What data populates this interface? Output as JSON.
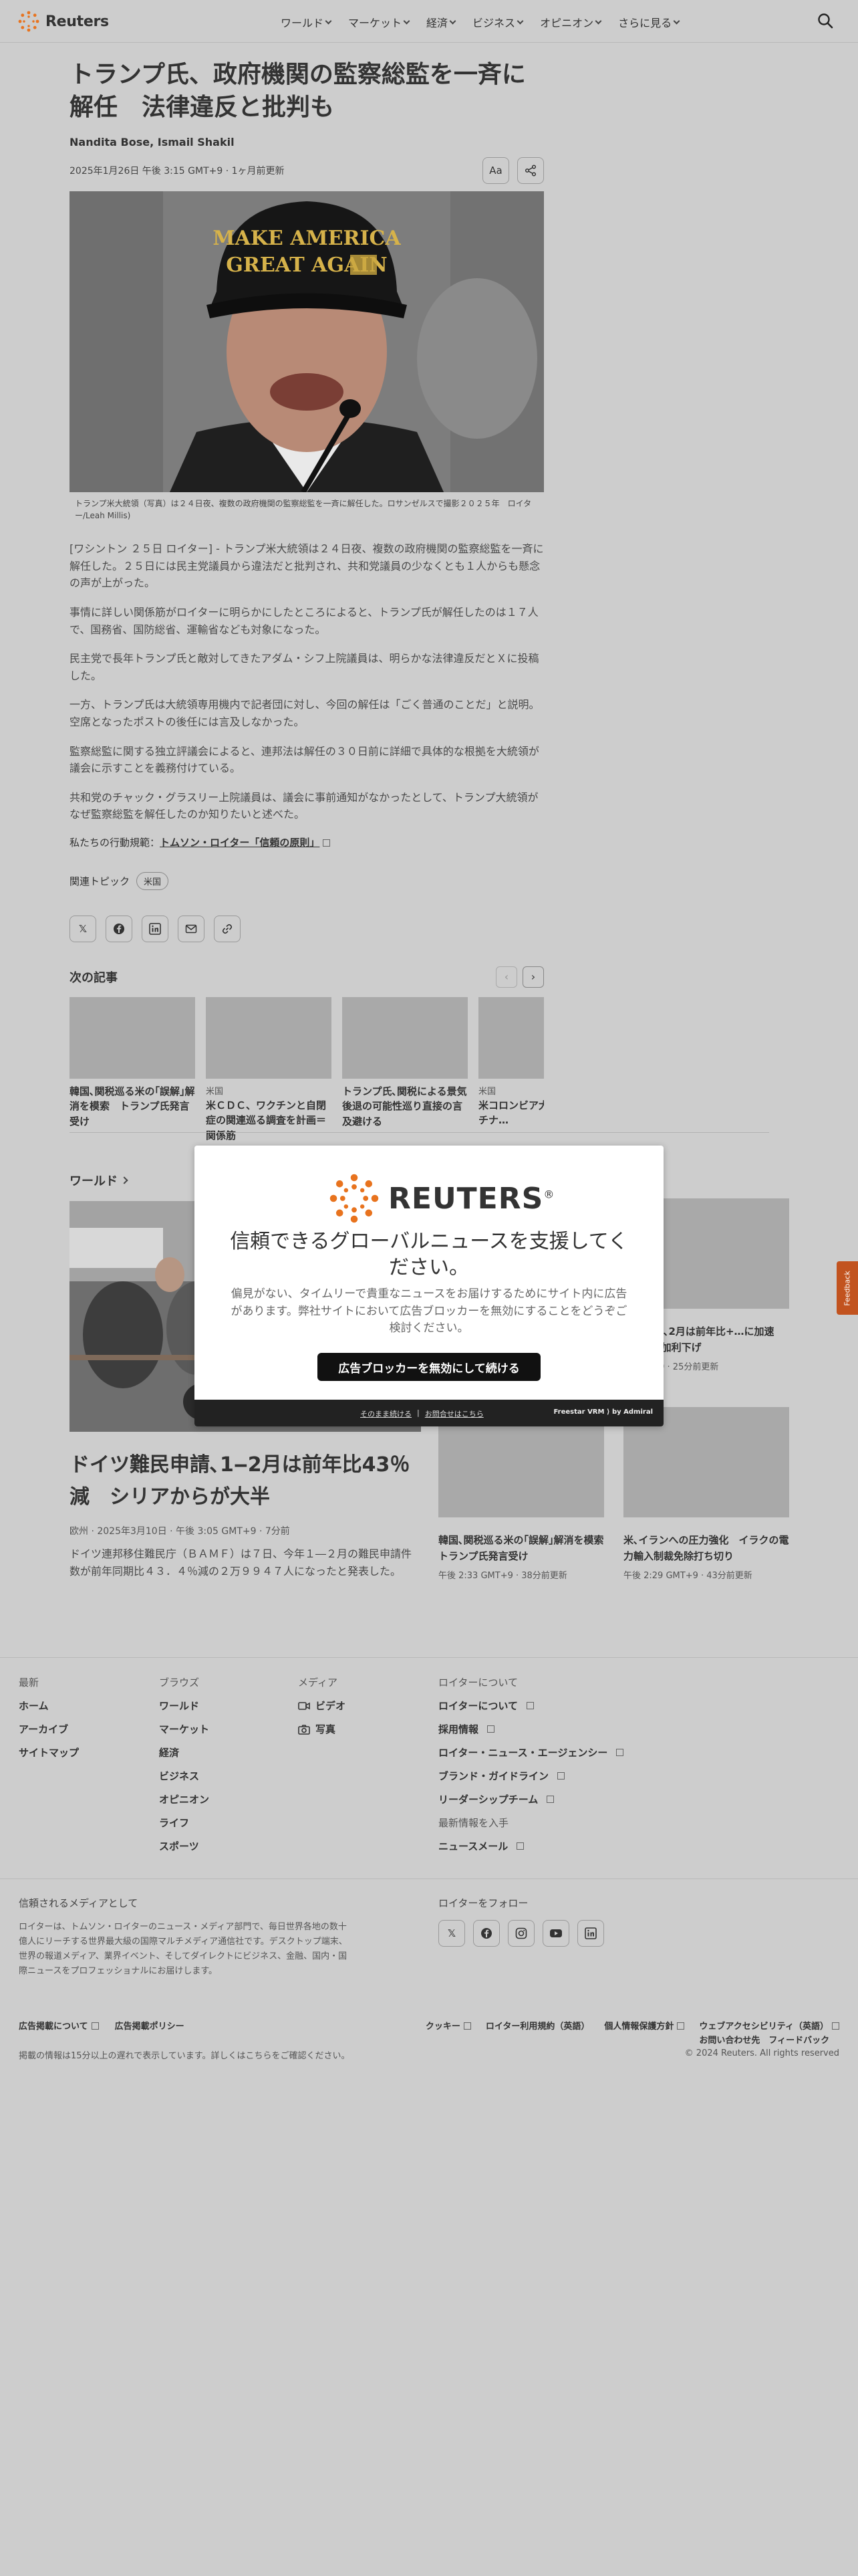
{
  "header": {
    "brand": "Reuters",
    "nav": [
      {
        "label": "ワールド"
      },
      {
        "label": "マーケット"
      },
      {
        "label": "経済"
      },
      {
        "label": "ビジネス"
      },
      {
        "label": "オピニオン"
      },
      {
        "label": "さらに見る"
      }
    ]
  },
  "article": {
    "headline": "トランプ氏、政府機関の監察総監を一斉に解任　法律違反と批判も",
    "byline": "Nandita Bose, Ismail Shakil",
    "dateline": "2025年1月26日 午後 3:15 GMT+9 · 1ヶ月前更新",
    "font_button": "Aa",
    "hero_cap_text": [
      "MAKE AMERICA",
      "GREAT AGAIN"
    ],
    "caption": "トランプ米大統領（写真）は２４日夜、複数の政府機関の監察総監を一斉に解任した。ロサンゼルスで撮影２０２５年　ロイター/Leah Millis)",
    "paragraphs": [
      "[ワシントン ２５日 ロイター] - トランプ米大統領は２４日夜、複数の政府機関の監察総監を一斉に解任した。２５日には民主党議員から違法だと批判され、共和党議員の少なくとも１人からも懸念の声が上がった。",
      "事情に詳しい関係筋がロイターに明らかにしたところによると、トランプ氏が解任したのは１７人で、国務省、国防総省、運輸省なども対象になった。",
      "民主党で長年トランプ氏と敵対してきたアダム・シフ上院議員は、明らかな法律違反だとＸに投稿した。",
      "一方、トランプ氏は大統領専用機内で記者団に対し、今回の解任は「ごく普通のことだ」と説明。空席となったポストの後任には言及しなかった。",
      "監察総監に関する独立評議会によると、連邦法は解任の３０日前に詳細で具体的な根拠を大統領が議会に示すことを義務付けている。",
      "共和党のチャック・グラスリー上院議員は、議会に事前通知がなかったとして、トランプ大統領がなぜ監察総監を解任したのか知りたいと述べた。"
    ],
    "principles_prefix": "私たちの行動規範：",
    "principles_link": "トムソン・ロイター「信頼の原則」",
    "topics_label": "関連トピック",
    "topics": [
      "米国"
    ],
    "next_title": "次の記事",
    "next_cards": [
      {
        "kicker": "",
        "title": "韓国､関税巡る米の｢誤解｣解消を模索　トランプ氏発言受け"
      },
      {
        "kicker": "米国",
        "title": "米ＣＤＣ、ワクチンと自閉症の関連巡る調査を計画＝関係筋"
      },
      {
        "kicker": "",
        "title": "トランプ氏､関税による景気後退の可能性巡り直接の言及避ける"
      },
      {
        "kicker": "米国",
        "title": "米コロンビア大、親パレスチナ…"
      }
    ]
  },
  "world": {
    "label": "ワールド",
    "lead": {
      "title": "ドイツ難民申請､1‒2月は前年比43％減　シリアからが大半",
      "meta": "欧州 · 2025年3月10日 · 午後 3:05 GMT+9 · 7分前",
      "desc": "ドイツ連邦移住難民庁（ＢＡＭＦ）は７日、今年１―２月の難民申請件数が前年同期比４３．４％減の２万９９４７人になったと発表した。"
    },
    "side_top_right": {
      "title": "…ＣＰＩ､2月は前年比+…に加速　0.5％追加利下げ",
      "time": "…GMT+9 · 25分前更新"
    },
    "side_bottom": [
      {
        "title": "韓国､関税巡る米の｢誤解｣解消を模索　トランプ氏発言受け",
        "time": "午後 2:33 GMT+9 · 38分前更新"
      },
      {
        "title": "米､イランへの圧力強化　イラクの電力輸入制裁免除打ち切り",
        "time": "午後 2:29 GMT+9 · 43分前更新"
      }
    ]
  },
  "modal": {
    "brand": "REUTERS",
    "title": "信頼できるグローバルニュースを支援してください。",
    "body": "偏見がない、タイムリーで貴重なニュースをお届けするためにサイト内に広告があります。弊社サイトにおいて広告ブロッカーを無効にすることをどうぞご検討ください。",
    "cta": "広告ブロッカーを無効にして続ける",
    "footer_links": [
      "そのまま続ける",
      "お問合せはこちら"
    ],
    "footer_brand": "Freestar VRM ⟩ by Admiral"
  },
  "feedback": "Feedback",
  "footer": {
    "col_latest": {
      "head": "最新",
      "links": [
        "ホーム",
        "アーカイブ",
        "サイトマップ"
      ]
    },
    "col_browse": {
      "head": "ブラウズ",
      "links": [
        "ワールド",
        "マーケット",
        "経済",
        "ビジネス",
        "オピニオン",
        "ライフ",
        "スポーツ"
      ]
    },
    "col_media": {
      "head": "メディア",
      "links": [
        "ビデオ",
        "写真"
      ]
    },
    "col_about": {
      "head": "ロイターについて",
      "links": [
        "ロイターについて",
        "採用情報",
        "ロイター・ニュース・エージェンシー",
        "ブランド・ガイドライン",
        "リーダーシップチーム"
      ],
      "sub": "最新情報を入手",
      "sub_links": [
        "ニュースメール"
      ]
    },
    "trust_head": "信頼されるメディアとして",
    "trust_text": "ロイターは、トムソン・ロイターのニュース・メディア部門で、毎日世界各地の数十億人にリーチする世界最大級の国際マルチメディア通信社です。デスクトップ端末、世界の報道メディア、業界イベント、そしてダイレクトにビジネス、金融、国内・国際ニュースをプロフェッショナルにお届けします。",
    "follow_head": "ロイターをフォロー",
    "legal_left": [
      "広告掲載について",
      "広告掲載ポリシー"
    ],
    "legal_right": [
      "クッキー",
      "ロイター利用規約（英語）",
      "個人情報保護方針"
    ],
    "legal_stack": [
      "ウェブアクセシビリティ（英語）",
      "お問い合わせ先　フィードバック"
    ],
    "note": "掲載の情報は15分以上の遅れで表示しています。詳しくはこちらをご確認ください。",
    "copyright": "© 2024 Reuters. All rights reserved"
  }
}
